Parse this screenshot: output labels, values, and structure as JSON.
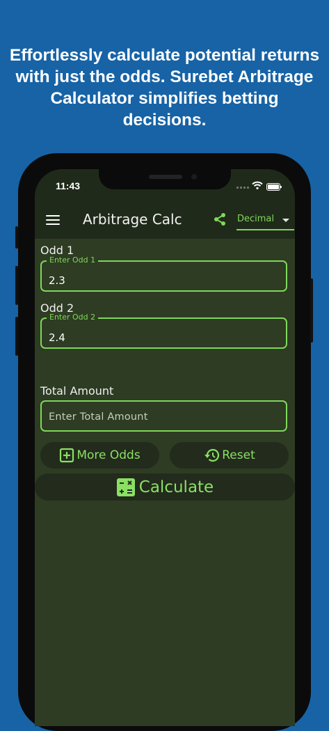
{
  "promo": {
    "headline": "Effortlessly calculate potential returns with just the odds. Surebet Arbitrage Calculator simplifies betting decisions."
  },
  "status": {
    "time": "11:43"
  },
  "app_bar": {
    "menu_icon": "hamburger-menu-icon",
    "title": "Arbitrage Calc",
    "share_icon": "share-icon",
    "odds_format": "Decimal"
  },
  "odds": [
    {
      "title": "Odd 1",
      "label": "Enter Odd 1",
      "value": "2.3"
    },
    {
      "title": "Odd 2",
      "label": "Enter Odd 2",
      "value": "2.4"
    }
  ],
  "total": {
    "title": "Total Amount",
    "placeholder": "Enter Total Amount"
  },
  "buttons": {
    "more_odds": "More Odds",
    "reset": "Reset",
    "calculate": "Calculate"
  },
  "colors": {
    "background": "#1763a6",
    "screen": "#2e3c23",
    "app_bar": "#202a1a",
    "accent": "#7fd85a"
  }
}
